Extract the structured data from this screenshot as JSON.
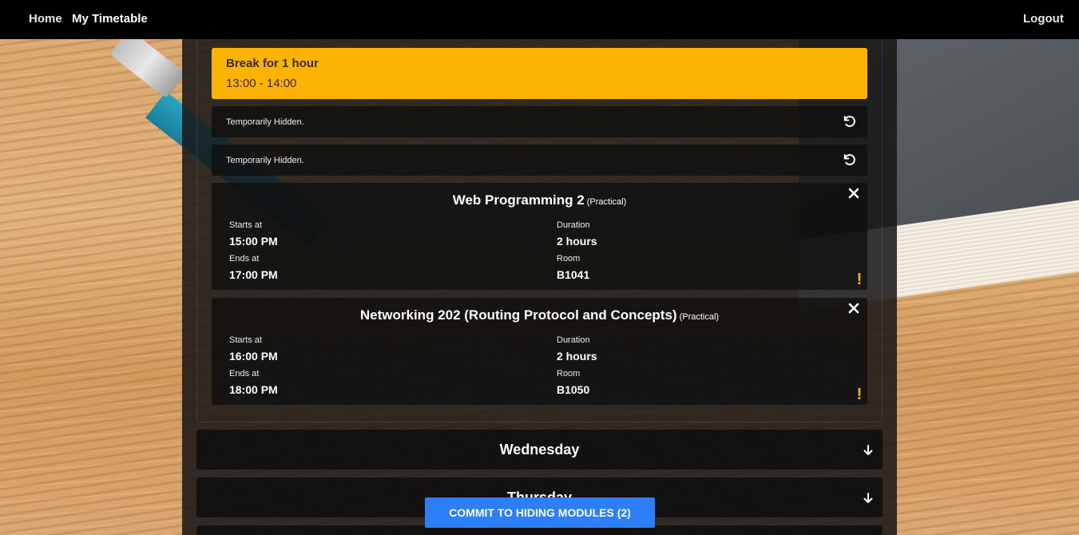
{
  "nav": {
    "home": "Home",
    "timetable": "My Timetable",
    "logout": "Logout"
  },
  "break": {
    "title": "Break for 1 hour",
    "time": "13:00 - 14:00"
  },
  "hidden_rows": [
    {
      "text": "Temporarily Hidden."
    },
    {
      "text": "Temporarily Hidden."
    }
  ],
  "modules": [
    {
      "name": "Web Programming 2",
      "type": "(Practical)",
      "starts_label": "Starts at",
      "starts": "15:00 PM",
      "duration_label": "Duration",
      "duration": "2 hours",
      "ends_label": "Ends at",
      "ends": "17:00 PM",
      "room_label": "Room",
      "room": "B1041"
    },
    {
      "name": "Networking 202 (Routing Protocol and Concepts)",
      "type": "(Practical)",
      "starts_label": "Starts at",
      "starts": "16:00 PM",
      "duration_label": "Duration",
      "duration": "2 hours",
      "ends_label": "Ends at",
      "ends": "18:00 PM",
      "room_label": "Room",
      "room": "B1050"
    }
  ],
  "days": [
    {
      "name": "Wednesday"
    },
    {
      "name": "Thursday"
    }
  ],
  "commit_button": "COMMIT TO HIDING MODULES (2)",
  "colors": {
    "break": "#fdb304",
    "button": "#2d7ff9",
    "warning": "#fdb304"
  },
  "icons": {
    "restore": "undo-icon",
    "remove": "close-icon",
    "warning": "exclamation-icon",
    "expand": "arrow-down-icon"
  }
}
